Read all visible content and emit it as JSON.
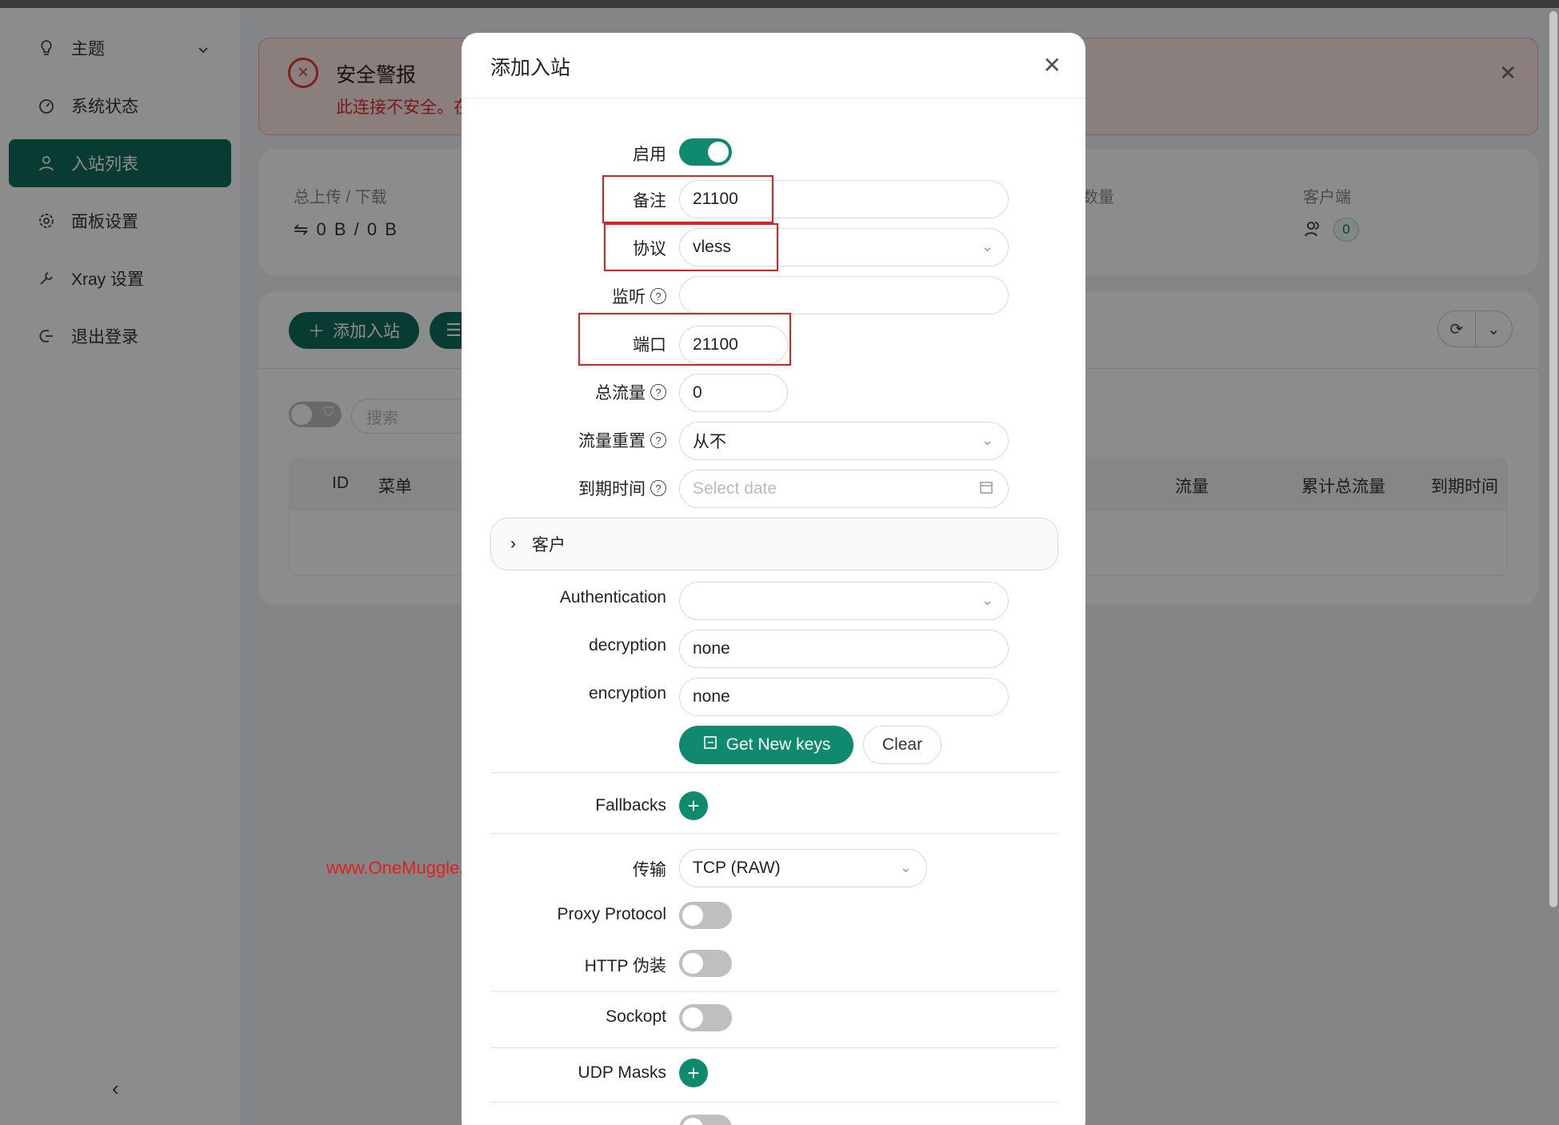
{
  "sidebar": {
    "items": [
      {
        "label": "主题"
      },
      {
        "label": "系统状态"
      },
      {
        "label": "入站列表"
      },
      {
        "label": "面板设置"
      },
      {
        "label": "Xray 设置"
      },
      {
        "label": "退出登录"
      }
    ]
  },
  "alert": {
    "title": "安全警报",
    "text": "此连接不安全。在"
  },
  "stats": {
    "updown_label": "总上传 / 下载",
    "updown_value": "⇋ 0 B / 0 B",
    "count_label": "数量",
    "clients_label": "客户端",
    "clients_value": "0"
  },
  "list": {
    "add_label": "添加入站",
    "search_placeholder": "搜索",
    "columns": [
      "ID",
      "菜单",
      "流量",
      "累计总流量",
      "到期时间"
    ]
  },
  "modal": {
    "title": "添加入站",
    "enable_label": "启用",
    "remark_label": "备注",
    "remark_value": "21100",
    "protocol_label": "协议",
    "protocol_value": "vless",
    "listen_label": "监听",
    "listen_value": "",
    "port_label": "端口",
    "port_value": "21100",
    "total_label": "总流量",
    "total_value": "0",
    "reset_label": "流量重置",
    "reset_value": "从不",
    "expiry_label": "到期时间",
    "expiry_placeholder": "Select date",
    "clients_section": "客户",
    "auth_label": "Authentication",
    "auth_value": "",
    "decryption_label": "decryption",
    "decryption_value": "none",
    "encryption_label": "encryption",
    "encryption_value": "none",
    "get_keys_label": "Get New keys",
    "clear_label": "Clear",
    "fallbacks_label": "Fallbacks",
    "transport_label": "传输",
    "transport_value": "TCP (RAW)",
    "proxy_protocol_label": "Proxy Protocol",
    "http_label": "HTTP 伪装",
    "sockopt_label": "Sockopt",
    "udp_masks_label": "UDP Masks"
  },
  "watermark": "www.OneMuggle.com"
}
